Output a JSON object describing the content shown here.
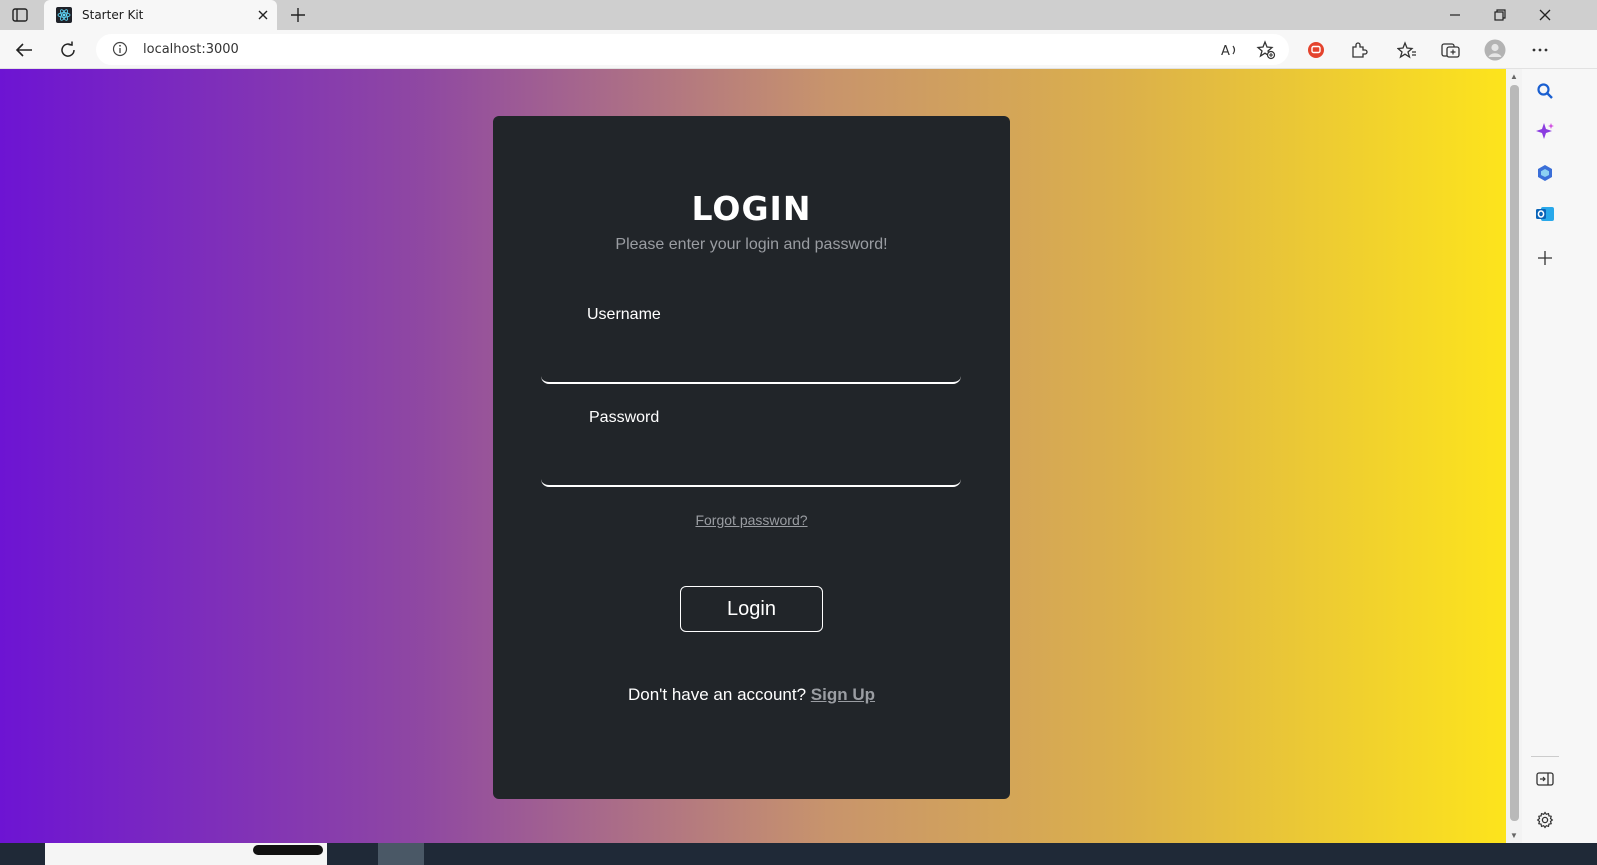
{
  "browser": {
    "tab_title": "Starter Kit",
    "address": "localhost:3000"
  },
  "login": {
    "title": "LOGIN",
    "subtitle": "Please enter your login and password!",
    "username_label": "Username",
    "username_value": "",
    "password_label": "Password",
    "password_value": "",
    "forgot_label": "Forgot password?",
    "button_label": "Login",
    "signup_prompt": "Don't have an account?",
    "signup_link": "Sign Up"
  },
  "colors": {
    "card_bg": "#212529",
    "gradient_start": "#6d14d3",
    "gradient_end": "#fde41c",
    "muted_text": "#9a9da2"
  }
}
